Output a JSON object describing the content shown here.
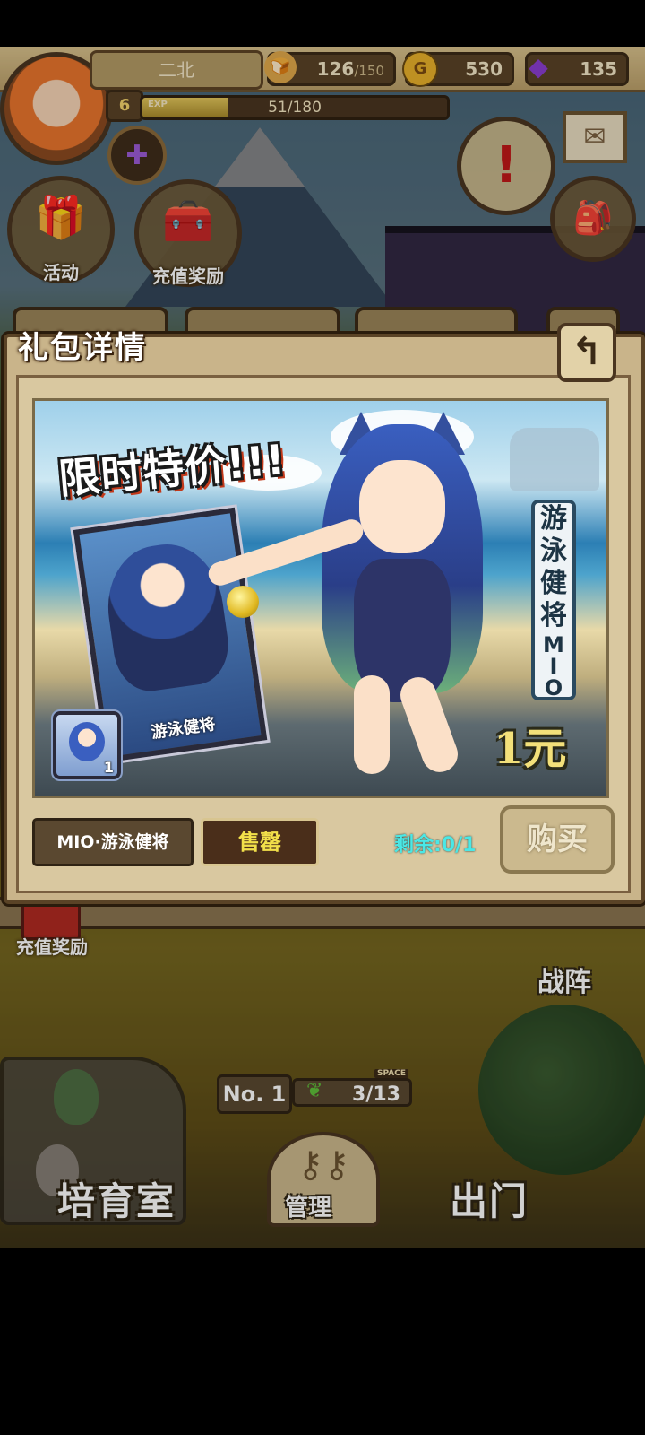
{
  "player": {
    "name": "二北",
    "level": "6",
    "exp_tag": "EXP",
    "exp_text": "51/180",
    "exp_fraction": 0.283
  },
  "resources": {
    "stamina_value": "126",
    "stamina_max": "/150",
    "gold": "530",
    "gems": "135"
  },
  "hud_buttons": {
    "activity": "活动",
    "recharge_reward": "充值奖励"
  },
  "modal": {
    "title": "礼包详情",
    "banner": {
      "promo_text": "限时特价!!!",
      "card_caption": "游泳健将",
      "vertical_tag": [
        "游",
        "泳",
        "健",
        "将"
      ],
      "vertical_tag_latin": [
        "M",
        "I",
        "O"
      ],
      "price": "1元",
      "item_count": "1"
    },
    "item_name": "MIO·游泳健将",
    "status": "售罄",
    "remaining": "剩余:0/1",
    "buy_label": "购买"
  },
  "bottom": {
    "recharge_reward": "充值奖励",
    "army": "战阵",
    "room_no": "No. 1",
    "space_tag": "SPACE",
    "space_value": "3/13",
    "nursery": "培育室",
    "manage": "管理",
    "go_out": "出门"
  },
  "colors": {
    "remaining_text": "#4ae8e6",
    "sold_out_text": "#f2e04a",
    "price_text": "#f3e07a"
  },
  "icons": {
    "stamina": "bread-icon",
    "gold": "gold-coin-icon",
    "gem": "purple-gem-icon",
    "mail": "mail-icon",
    "back": "back-arrow-icon",
    "quest": "quest-scroll-icon",
    "bag": "backpack-icon"
  }
}
